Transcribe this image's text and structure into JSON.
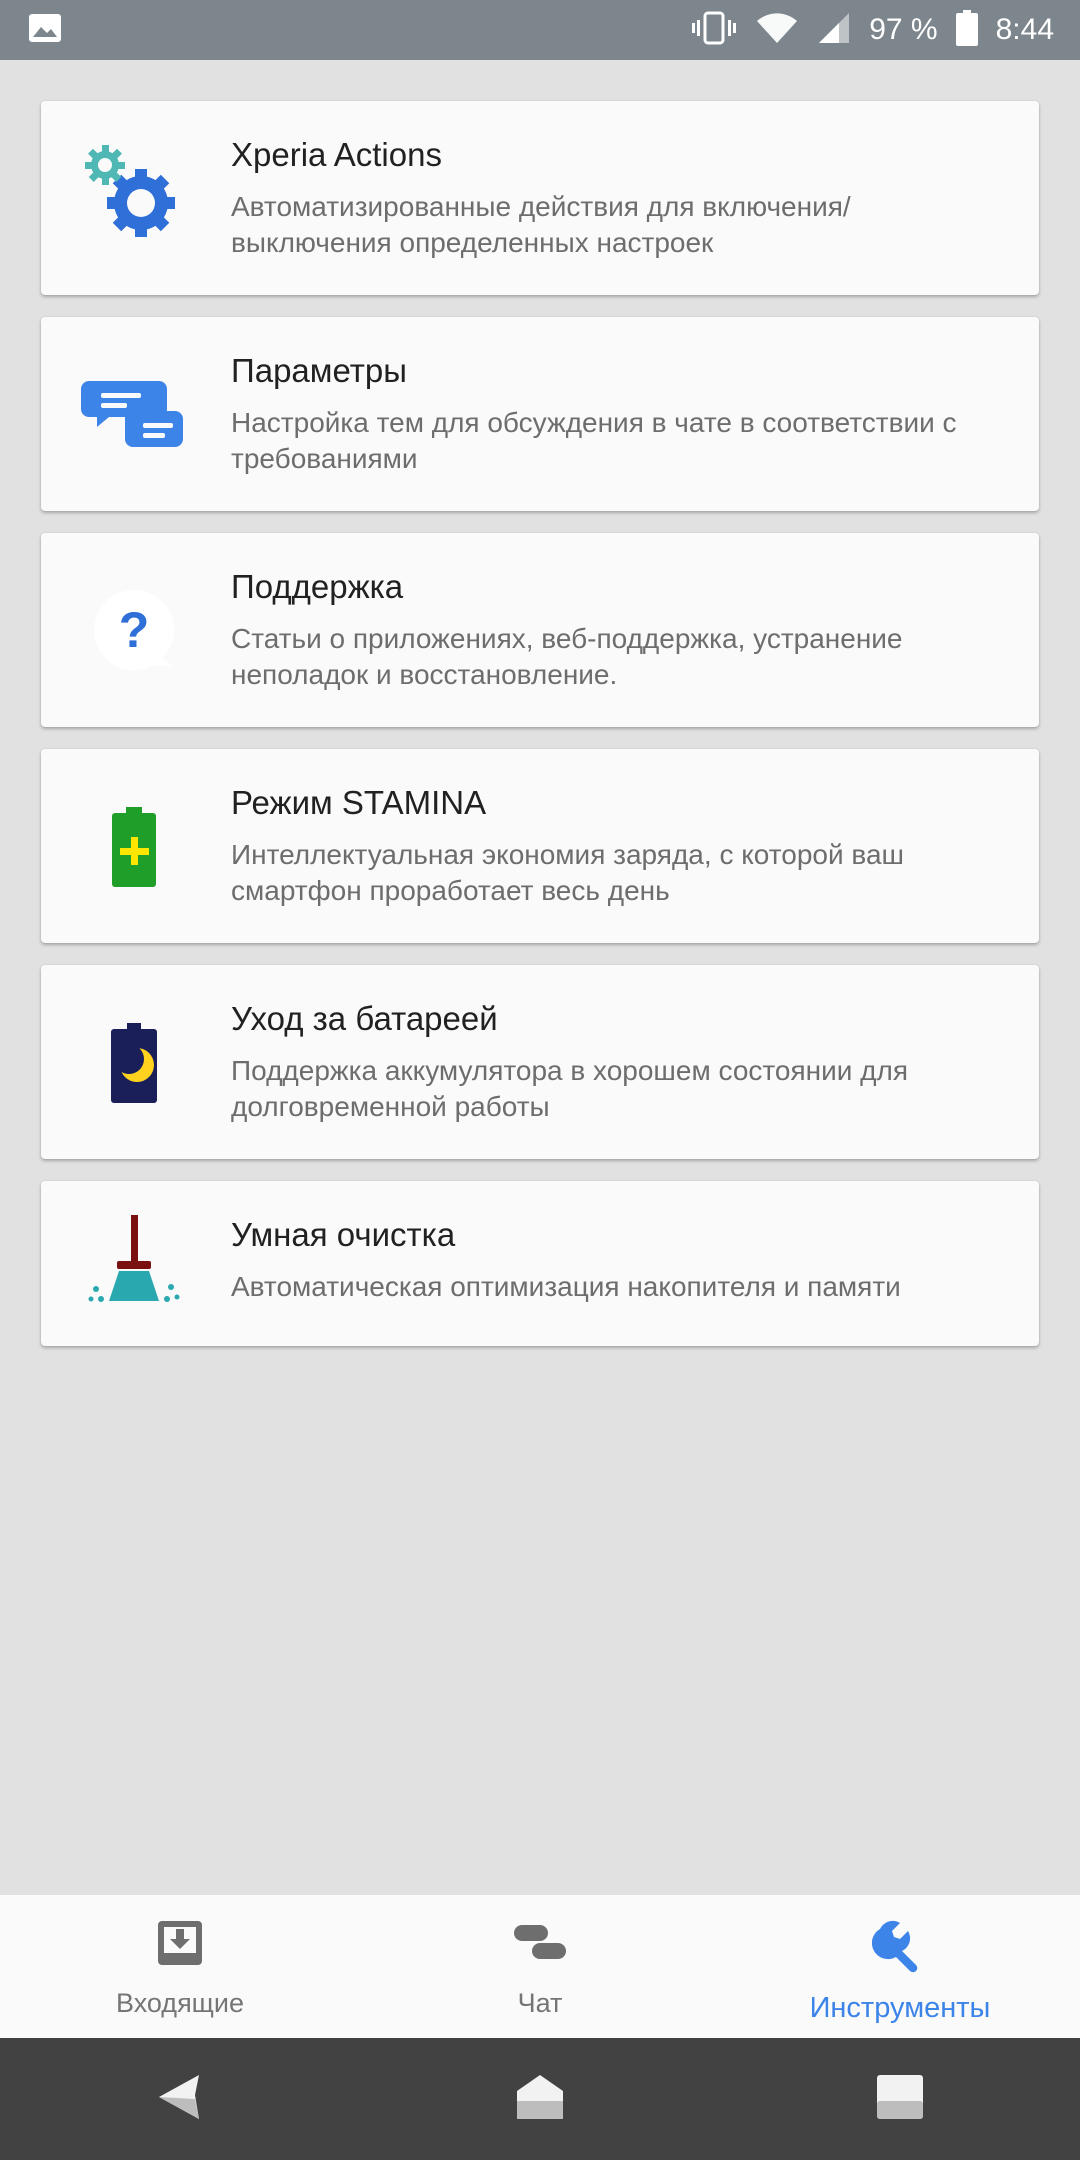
{
  "status_bar": {
    "battery_percent": "97 %",
    "time": "8:44"
  },
  "cards": [
    {
      "title": "Xperia Actions",
      "description": "Автоматизированные действия для включения/ выключения определенных настроек",
      "icon": "gears-icon"
    },
    {
      "title": "Параметры",
      "description": "Настройка тем для обсуждения в чате в соответствии с требованиями",
      "icon": "chat-bubbles-icon"
    },
    {
      "title": "Поддержка",
      "description": "Статьи о приложениях, веб-поддержка, устранение неполадок и восстановление.",
      "icon": "help-bubble-icon"
    },
    {
      "title": "Режим STAMINA",
      "description": "Интеллектуальная экономия заряда, с которой ваш смартфон проработает весь день",
      "icon": "stamina-battery-icon"
    },
    {
      "title": "Уход за батареей",
      "description": "Поддержка аккумулятора в хорошем состоянии для долговременной работы",
      "icon": "battery-moon-icon"
    },
    {
      "title": "Умная очистка",
      "description": "Автоматическая оптимизация накопителя и памяти",
      "icon": "broom-icon"
    }
  ],
  "bottom_nav": {
    "items": [
      {
        "label": "Входящие",
        "icon": "inbox-icon",
        "active": false
      },
      {
        "label": "Чат",
        "icon": "chat-icon",
        "active": false
      },
      {
        "label": "Инструменты",
        "icon": "wrench-icon",
        "active": true
      }
    ]
  },
  "colors": {
    "status_bar": "#7c868c",
    "accent": "#3d84e8",
    "background": "#e1e1e1",
    "card": "#fafafa",
    "system_nav": "#424242"
  }
}
